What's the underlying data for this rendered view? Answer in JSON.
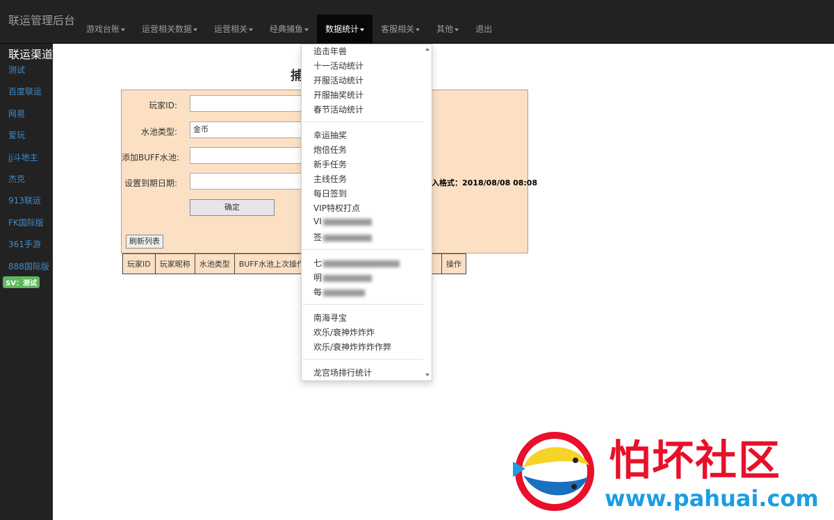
{
  "navbar": {
    "brand": "联运管理后台",
    "items": [
      {
        "label": "游戏台账",
        "dropdown": true
      },
      {
        "label": "运营相关数据",
        "dropdown": true
      },
      {
        "label": "运营相关",
        "dropdown": true
      },
      {
        "label": "经典捕鱼",
        "dropdown": true
      },
      {
        "label": "数据统计",
        "dropdown": true,
        "active": true
      },
      {
        "label": "客服相关",
        "dropdown": true
      },
      {
        "label": "其他",
        "dropdown": true
      },
      {
        "label": "退出",
        "dropdown": false
      }
    ]
  },
  "sidebar": {
    "title": "联运渠道",
    "items": [
      "测试",
      "百度联运",
      "网易",
      "爱玩",
      "jj斗地主",
      "杰克",
      "913联运",
      "FK国际版",
      "361手游",
      "888国际版"
    ],
    "badge": "SV：测试"
  },
  "main": {
    "title": "捕",
    "form": {
      "player_id_label": "玩家ID:",
      "player_id_value": "",
      "pool_type_label": "水池类型:",
      "pool_type_value": "金币",
      "buff_pool_label": "添加BUFF水池:",
      "buff_pool_value": "",
      "expire_label": "设置到期日期:",
      "expire_value": "",
      "hint": "入格式：2018/08/08 08:08",
      "confirm_label": "确定",
      "refresh_label": "刷新列表"
    },
    "table_headers": [
      "玩家ID",
      "玩家昵称",
      "水池类型",
      "BUFF水池上次操作时",
      "",
      "",
      "操作"
    ]
  },
  "dropdown": {
    "groups": [
      [
        "追击年兽",
        "十一活动统计",
        "开服活动统计",
        "开服抽奖统计",
        "春节活动统计"
      ],
      [
        "幸运抽奖",
        "炮倍任务",
        "新手任务",
        "主线任务",
        "每日签到",
        "VIP特权打点",
        "VI",
        "签"
      ],
      [
        "七",
        "明",
        "每"
      ],
      [
        "南海寻宝",
        "欢乐/衰神炸炸炸",
        "欢乐/衰神炸炸炸作弊"
      ],
      [
        "龙宫场排行统计"
      ]
    ]
  },
  "watermark": {
    "text": "怕坏社区",
    "url": "www.pahuai.com"
  },
  "colors": {
    "navbar_bg": "#222222",
    "panel_bg": "#fbe0c4",
    "link": "#428bca",
    "badge": "#5cb85c",
    "logo_red": "#e8102a",
    "logo_blue": "#1b9ee0"
  }
}
